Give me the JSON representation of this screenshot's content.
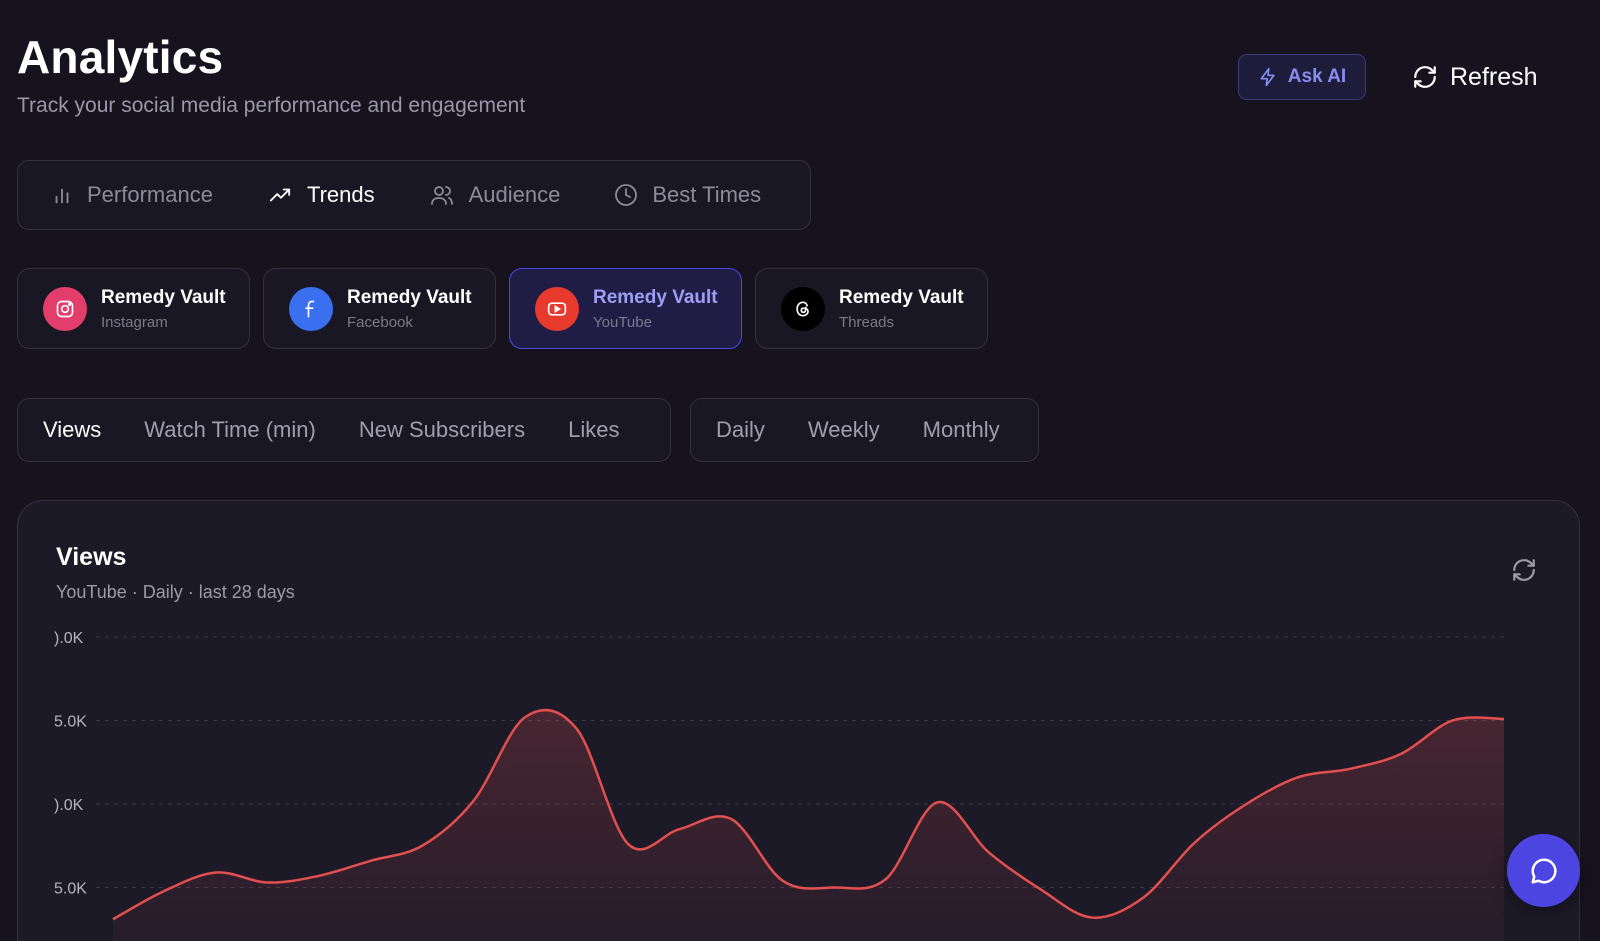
{
  "header": {
    "title": "Analytics",
    "subtitle": "Track your social media performance and engagement",
    "ask_ai_label": "Ask AI",
    "refresh_label": "Refresh"
  },
  "tabs": [
    {
      "label": "Performance",
      "icon": "bar-chart-icon",
      "active": false
    },
    {
      "label": "Trends",
      "icon": "trending-up-icon",
      "active": true
    },
    {
      "label": "Audience",
      "icon": "users-icon",
      "active": false
    },
    {
      "label": "Best Times",
      "icon": "clock-icon",
      "active": false
    }
  ],
  "accounts": [
    {
      "name": "Remedy Vault",
      "platform": "Instagram",
      "color": "#e23d6b",
      "selected": false
    },
    {
      "name": "Remedy Vault",
      "platform": "Facebook",
      "color": "#3a6ff0",
      "selected": false
    },
    {
      "name": "Remedy Vault",
      "platform": "YouTube",
      "color": "#e8392d",
      "selected": true
    },
    {
      "name": "Remedy Vault",
      "platform": "Threads",
      "color": "#000000",
      "selected": false
    }
  ],
  "metrics": [
    "Views",
    "Watch Time (min)",
    "New Subscribers",
    "Likes"
  ],
  "active_metric": "Views",
  "periods": [
    "Daily",
    "Weekly",
    "Monthly"
  ],
  "active_period": "Daily",
  "chart_card": {
    "title": "Views",
    "subtitle": "YouTube · Daily · last 28 days"
  },
  "chart_data": {
    "type": "area",
    "title": "Views",
    "subtitle": "YouTube · Daily · last 28 days",
    "y_tick_labels": [
      ").0K",
      "5.0K",
      ").0K",
      "5.0K"
    ],
    "y_ticks": [
      20000,
      15000,
      10000,
      5000
    ],
    "ylim": [
      0,
      20000
    ],
    "values": [
      3100,
      4800,
      5900,
      5300,
      5700,
      6600,
      7500,
      10200,
      15200,
      14500,
      7600,
      8500,
      9100,
      5400,
      5000,
      5500,
      10100,
      7100,
      4900,
      3200,
      4400,
      7700,
      10000,
      11600,
      12100,
      13000,
      15000,
      15100
    ],
    "line_color": "#e24f4f",
    "grid": true
  }
}
